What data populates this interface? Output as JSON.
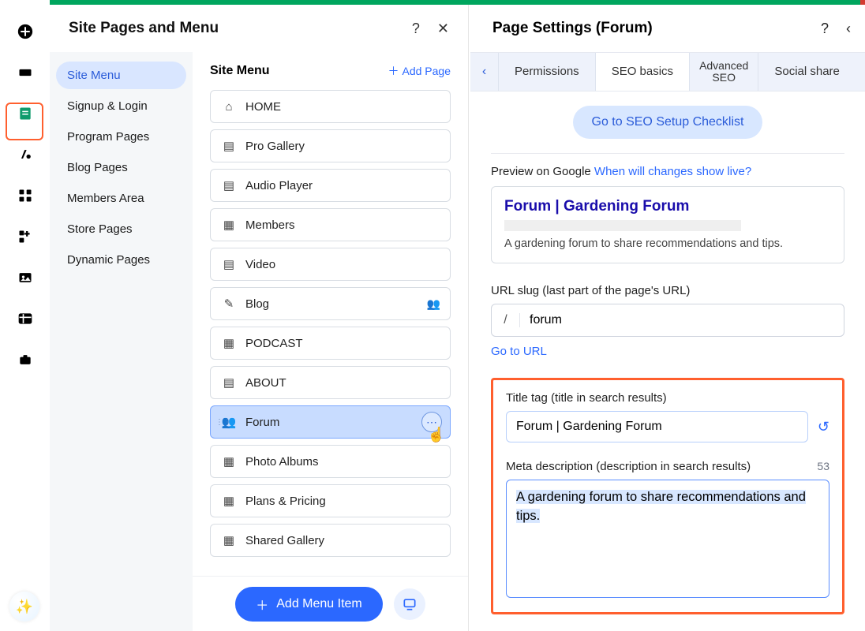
{
  "icon_rail": {
    "items": [
      "add",
      "section",
      "pages",
      "design",
      "apps",
      "apps2",
      "media",
      "table",
      "store"
    ],
    "ai_glyph": "✨"
  },
  "panel1": {
    "title": "Site Pages and Menu",
    "help_glyph": "?",
    "close_glyph": "✕",
    "nav": [
      {
        "label": "Site Menu",
        "active": true
      },
      {
        "label": "Signup & Login"
      },
      {
        "label": "Program Pages"
      },
      {
        "label": "Blog Pages"
      },
      {
        "label": "Members Area"
      },
      {
        "label": "Store Pages"
      },
      {
        "label": "Dynamic Pages"
      }
    ],
    "list_title": "Site Menu",
    "add_page_label": "Add Page",
    "pages": [
      {
        "icon": "home",
        "label": "HOME"
      },
      {
        "icon": "doc",
        "label": "Pro Gallery"
      },
      {
        "icon": "doc",
        "label": "Audio Player"
      },
      {
        "icon": "grid",
        "label": "Members"
      },
      {
        "icon": "doc",
        "label": "Video"
      },
      {
        "icon": "pen",
        "label": "Blog",
        "right": "people"
      },
      {
        "icon": "grid",
        "label": "PODCAST"
      },
      {
        "icon": "doc",
        "label": "ABOUT"
      },
      {
        "icon": "people",
        "label": "Forum",
        "selected": true,
        "more": "⋯"
      },
      {
        "icon": "grid",
        "label": "Photo Albums"
      },
      {
        "icon": "grid",
        "label": "Plans & Pricing"
      },
      {
        "icon": "grid",
        "label": "Shared Gallery"
      }
    ],
    "add_menu_item": "Add Menu Item",
    "cursor_glyph": "☝"
  },
  "panel2": {
    "title": "Page Settings (Forum)",
    "help_glyph": "?",
    "back_glyph": "‹",
    "tabs_arrow": "‹",
    "tabs": [
      {
        "label": "Permissions"
      },
      {
        "label": "SEO basics",
        "active": true
      },
      {
        "label": "Advanced SEO",
        "small": true,
        "two_line": true
      },
      {
        "label": "Social share"
      }
    ],
    "checklist_btn": "Go to SEO Setup Checklist",
    "preview_label": "Preview on Google ",
    "preview_link": "When will changes show live?",
    "google": {
      "title": "Forum | Gardening Forum",
      "desc": "A gardening forum to share recommendations and tips."
    },
    "slug": {
      "label": "URL slug (last part of the page's URL)",
      "prefix": "/",
      "value": "forum",
      "go_url": "Go to URL"
    },
    "title_tag": {
      "label": "Title tag (title in search results)",
      "value": "Forum | Gardening Forum",
      "reset_glyph": "↺"
    },
    "meta": {
      "label": "Meta description (description in search results)",
      "count": "53",
      "value": "A gardening forum to share recommendations and tips."
    }
  }
}
